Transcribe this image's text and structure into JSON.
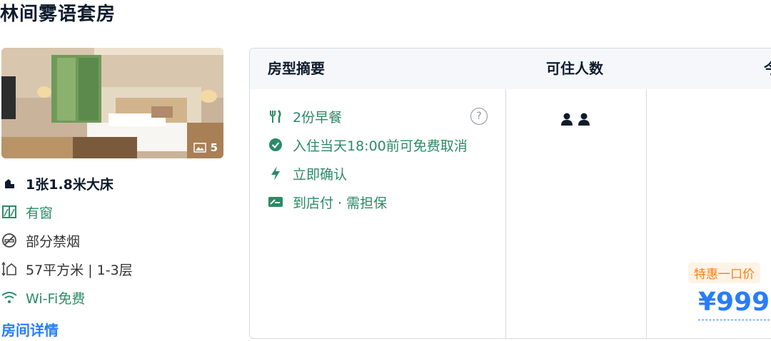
{
  "room": {
    "name": "林间雾语套房",
    "photo_count": "5",
    "details_link": "房间详情"
  },
  "facilities": [
    {
      "icon": "bed-icon",
      "label": "1张1.8米大床"
    },
    {
      "icon": "window-icon",
      "label": "有窗"
    },
    {
      "icon": "no-smoking-icon",
      "label": "部分禁烟"
    },
    {
      "icon": "area-icon",
      "label": "57平方米 | 1-3层"
    },
    {
      "icon": "wifi-icon",
      "label": "Wi-Fi免费"
    }
  ],
  "table": {
    "headers": [
      "房型摘要",
      "可住人数",
      "今"
    ],
    "summary": [
      {
        "icon": "breakfast-icon",
        "label": "2份早餐"
      },
      {
        "icon": "check-circle-icon",
        "label": "入住当天18:00前可免费取消"
      },
      {
        "icon": "lightning-icon",
        "label": "立即确认"
      },
      {
        "icon": "pay-at-hotel-icon",
        "label": "到店付 · 需担保"
      }
    ],
    "guest_count": 2
  },
  "price": {
    "deal_label": "特惠一口价",
    "amount": "¥999"
  },
  "colors": {
    "accent_blue": "#287dfa",
    "green": "#2b8a66",
    "orange": "#ff7d13"
  }
}
